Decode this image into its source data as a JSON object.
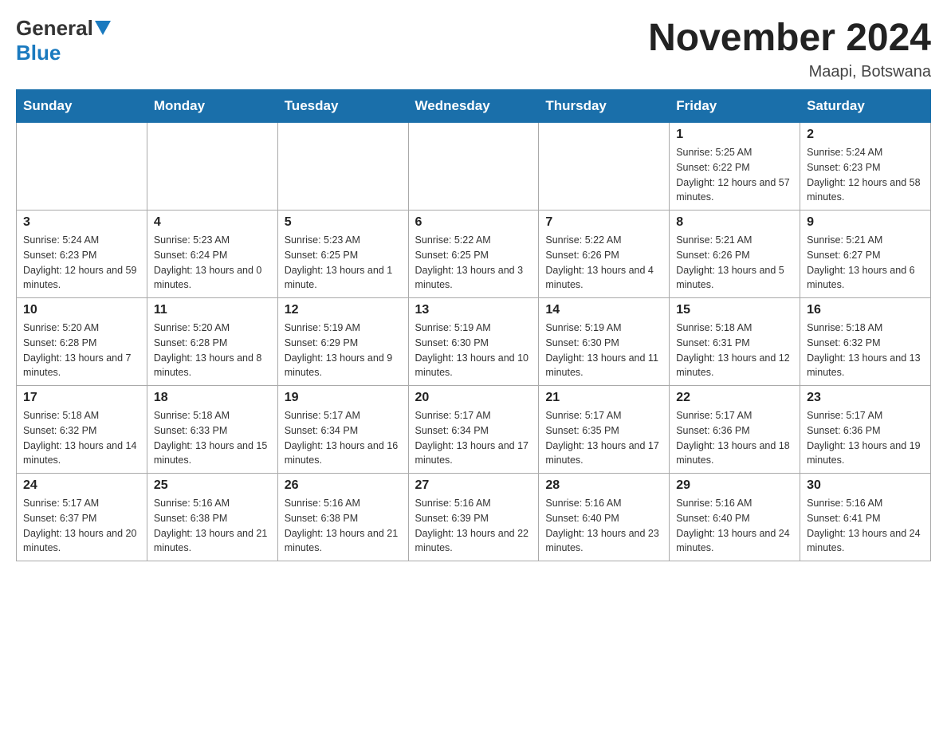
{
  "logo": {
    "general": "General",
    "blue": "Blue"
  },
  "title": "November 2024",
  "location": "Maapi, Botswana",
  "weekdays": [
    "Sunday",
    "Monday",
    "Tuesday",
    "Wednesday",
    "Thursday",
    "Friday",
    "Saturday"
  ],
  "weeks": [
    [
      {
        "day": "",
        "info": ""
      },
      {
        "day": "",
        "info": ""
      },
      {
        "day": "",
        "info": ""
      },
      {
        "day": "",
        "info": ""
      },
      {
        "day": "",
        "info": ""
      },
      {
        "day": "1",
        "info": "Sunrise: 5:25 AM\nSunset: 6:22 PM\nDaylight: 12 hours and 57 minutes."
      },
      {
        "day": "2",
        "info": "Sunrise: 5:24 AM\nSunset: 6:23 PM\nDaylight: 12 hours and 58 minutes."
      }
    ],
    [
      {
        "day": "3",
        "info": "Sunrise: 5:24 AM\nSunset: 6:23 PM\nDaylight: 12 hours and 59 minutes."
      },
      {
        "day": "4",
        "info": "Sunrise: 5:23 AM\nSunset: 6:24 PM\nDaylight: 13 hours and 0 minutes."
      },
      {
        "day": "5",
        "info": "Sunrise: 5:23 AM\nSunset: 6:25 PM\nDaylight: 13 hours and 1 minute."
      },
      {
        "day": "6",
        "info": "Sunrise: 5:22 AM\nSunset: 6:25 PM\nDaylight: 13 hours and 3 minutes."
      },
      {
        "day": "7",
        "info": "Sunrise: 5:22 AM\nSunset: 6:26 PM\nDaylight: 13 hours and 4 minutes."
      },
      {
        "day": "8",
        "info": "Sunrise: 5:21 AM\nSunset: 6:26 PM\nDaylight: 13 hours and 5 minutes."
      },
      {
        "day": "9",
        "info": "Sunrise: 5:21 AM\nSunset: 6:27 PM\nDaylight: 13 hours and 6 minutes."
      }
    ],
    [
      {
        "day": "10",
        "info": "Sunrise: 5:20 AM\nSunset: 6:28 PM\nDaylight: 13 hours and 7 minutes."
      },
      {
        "day": "11",
        "info": "Sunrise: 5:20 AM\nSunset: 6:28 PM\nDaylight: 13 hours and 8 minutes."
      },
      {
        "day": "12",
        "info": "Sunrise: 5:19 AM\nSunset: 6:29 PM\nDaylight: 13 hours and 9 minutes."
      },
      {
        "day": "13",
        "info": "Sunrise: 5:19 AM\nSunset: 6:30 PM\nDaylight: 13 hours and 10 minutes."
      },
      {
        "day": "14",
        "info": "Sunrise: 5:19 AM\nSunset: 6:30 PM\nDaylight: 13 hours and 11 minutes."
      },
      {
        "day": "15",
        "info": "Sunrise: 5:18 AM\nSunset: 6:31 PM\nDaylight: 13 hours and 12 minutes."
      },
      {
        "day": "16",
        "info": "Sunrise: 5:18 AM\nSunset: 6:32 PM\nDaylight: 13 hours and 13 minutes."
      }
    ],
    [
      {
        "day": "17",
        "info": "Sunrise: 5:18 AM\nSunset: 6:32 PM\nDaylight: 13 hours and 14 minutes."
      },
      {
        "day": "18",
        "info": "Sunrise: 5:18 AM\nSunset: 6:33 PM\nDaylight: 13 hours and 15 minutes."
      },
      {
        "day": "19",
        "info": "Sunrise: 5:17 AM\nSunset: 6:34 PM\nDaylight: 13 hours and 16 minutes."
      },
      {
        "day": "20",
        "info": "Sunrise: 5:17 AM\nSunset: 6:34 PM\nDaylight: 13 hours and 17 minutes."
      },
      {
        "day": "21",
        "info": "Sunrise: 5:17 AM\nSunset: 6:35 PM\nDaylight: 13 hours and 17 minutes."
      },
      {
        "day": "22",
        "info": "Sunrise: 5:17 AM\nSunset: 6:36 PM\nDaylight: 13 hours and 18 minutes."
      },
      {
        "day": "23",
        "info": "Sunrise: 5:17 AM\nSunset: 6:36 PM\nDaylight: 13 hours and 19 minutes."
      }
    ],
    [
      {
        "day": "24",
        "info": "Sunrise: 5:17 AM\nSunset: 6:37 PM\nDaylight: 13 hours and 20 minutes."
      },
      {
        "day": "25",
        "info": "Sunrise: 5:16 AM\nSunset: 6:38 PM\nDaylight: 13 hours and 21 minutes."
      },
      {
        "day": "26",
        "info": "Sunrise: 5:16 AM\nSunset: 6:38 PM\nDaylight: 13 hours and 21 minutes."
      },
      {
        "day": "27",
        "info": "Sunrise: 5:16 AM\nSunset: 6:39 PM\nDaylight: 13 hours and 22 minutes."
      },
      {
        "day": "28",
        "info": "Sunrise: 5:16 AM\nSunset: 6:40 PM\nDaylight: 13 hours and 23 minutes."
      },
      {
        "day": "29",
        "info": "Sunrise: 5:16 AM\nSunset: 6:40 PM\nDaylight: 13 hours and 24 minutes."
      },
      {
        "day": "30",
        "info": "Sunrise: 5:16 AM\nSunset: 6:41 PM\nDaylight: 13 hours and 24 minutes."
      }
    ]
  ]
}
